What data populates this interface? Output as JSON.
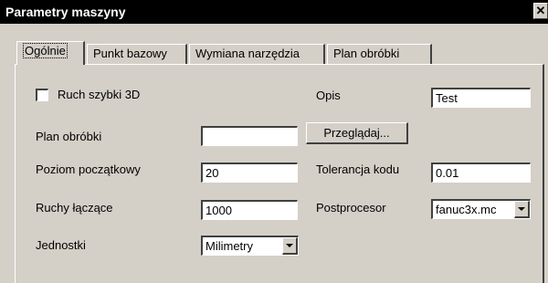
{
  "window": {
    "title": "Parametry maszyny",
    "close_glyph": "✕"
  },
  "tabs": [
    {
      "label": "Ogólnie"
    },
    {
      "label": "Punkt bazowy"
    },
    {
      "label": "Wymiana narzędzia"
    },
    {
      "label": "Plan obróbki"
    }
  ],
  "form": {
    "rapid3d": {
      "label": "Ruch szybki 3D",
      "checked": false
    },
    "opis": {
      "label": "Opis",
      "value": "Test"
    },
    "plan": {
      "label": "Plan obróbki",
      "value": "",
      "browse_label": "Przeglądaj..."
    },
    "poziom": {
      "label": "Poziom początkowy",
      "value": "20"
    },
    "tolerancja": {
      "label": "Tolerancja kodu",
      "value": "0.01"
    },
    "ruchy": {
      "label": "Ruchy łączące",
      "value": "1000"
    },
    "postprocesor": {
      "label": "Postprocesor",
      "value": "fanuc3x.mc"
    },
    "jednostki": {
      "label": "Jednostki",
      "value": "Milimetry"
    }
  }
}
